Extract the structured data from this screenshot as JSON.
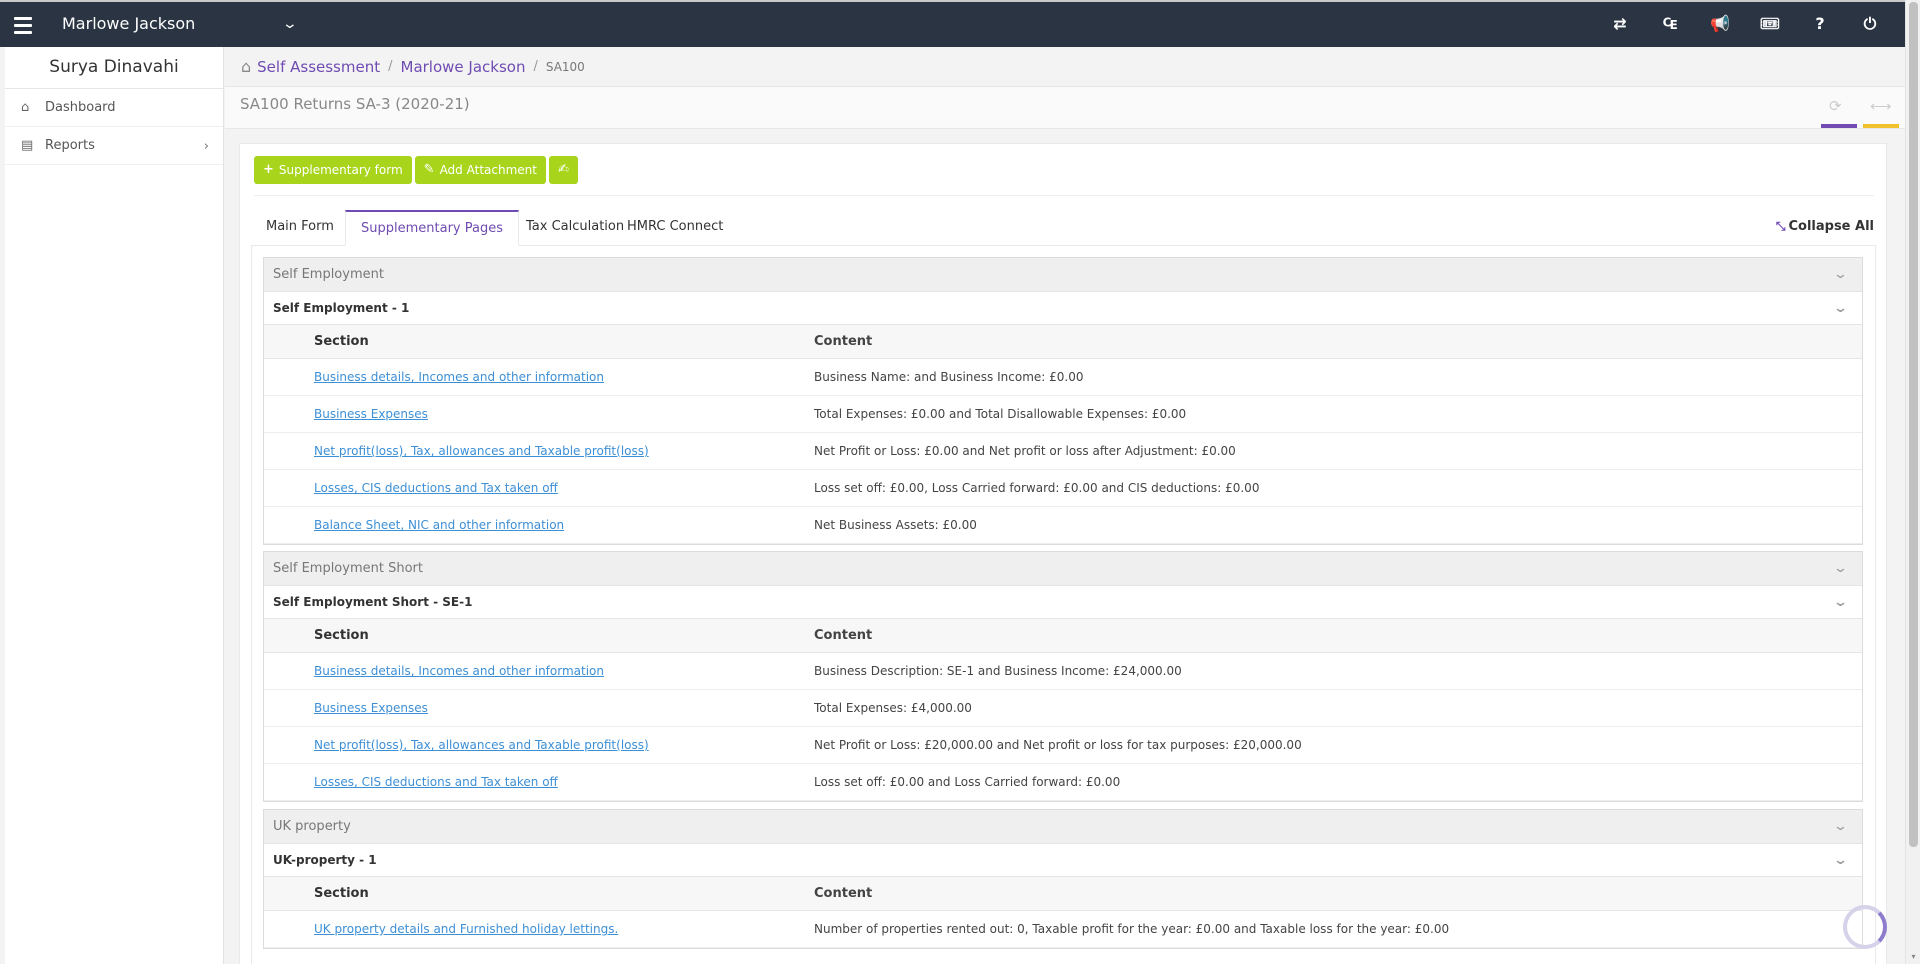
{
  "topbar": {
    "client_name": "Marlowe Jackson",
    "icons": [
      "transfer-icon",
      "currency-icon",
      "bullhorn-icon",
      "ticket-icon",
      "help-icon",
      "power-icon"
    ]
  },
  "sidebar": {
    "user_name": "Surya Dinavahi",
    "items": [
      {
        "label": "Dashboard",
        "icon": "home-icon"
      },
      {
        "label": "Reports",
        "icon": "file-icon"
      }
    ]
  },
  "breadcrumb": {
    "items": [
      "Self Assessment",
      "Marlowe Jackson"
    ],
    "current": "SA100"
  },
  "page": {
    "title": "SA100 Returns SA-3 (2020-21)"
  },
  "toolbar": {
    "supplementary_label": "Supplementary form",
    "attachment_label": "Add Attachment"
  },
  "tabs": [
    {
      "label": "Main Form"
    },
    {
      "label": "Supplementary Pages",
      "active": true
    },
    {
      "label": "Tax Calculation"
    },
    {
      "label": "HMRC Connect"
    }
  ],
  "collapse_all_label": "Collapse All",
  "columns": {
    "section": "Section",
    "content": "Content"
  },
  "groups": [
    {
      "title": "Self Employment",
      "subtitle": "Self Employment - 1",
      "rows": [
        {
          "section": "Business details, Incomes and other information",
          "content": "Business Name: and Business Income: £0.00"
        },
        {
          "section": "Business Expenses",
          "content": "Total Expenses: £0.00 and Total Disallowable Expenses: £0.00"
        },
        {
          "section": "Net profit(loss), Tax, allowances and Taxable profit(loss)",
          "content": "Net Profit or Loss: £0.00 and Net profit or loss after Adjustment: £0.00"
        },
        {
          "section": "Losses, CIS deductions and Tax taken off",
          "content": "Loss set off: £0.00, Loss Carried forward: £0.00 and CIS deductions: £0.00"
        },
        {
          "section": "Balance Sheet, NIC and other information",
          "content": "Net Business Assets: £0.00"
        }
      ]
    },
    {
      "title": "Self Employment Short",
      "subtitle": "Self Employment Short - SE-1",
      "rows": [
        {
          "section": "Business details, Incomes and other information",
          "content": "Business Description: SE-1 and Business Income: £24,000.00"
        },
        {
          "section": "Business Expenses",
          "content": "Total Expenses: £4,000.00"
        },
        {
          "section": "Net profit(loss), Tax, allowances and Taxable profit(loss)",
          "content": "Net Profit or Loss: £20,000.00 and Net profit or loss for tax purposes: £20,000.00"
        },
        {
          "section": "Losses, CIS deductions and Tax taken off",
          "content": "Loss set off: £0.00 and Loss Carried forward: £0.00"
        }
      ]
    },
    {
      "title": "UK property",
      "subtitle": "UK-property - 1",
      "rows": [
        {
          "section": "UK property details and Furnished holiday lettings.",
          "content": "Number of properties rented out: 0, Taxable profit for the year: £0.00 and Taxable loss for the year: £0.00"
        }
      ]
    }
  ],
  "colors": {
    "topbar": "#2a3442",
    "accent": "#6f4bb2",
    "button": "#a8d51c",
    "link": "#3d8fd6"
  }
}
